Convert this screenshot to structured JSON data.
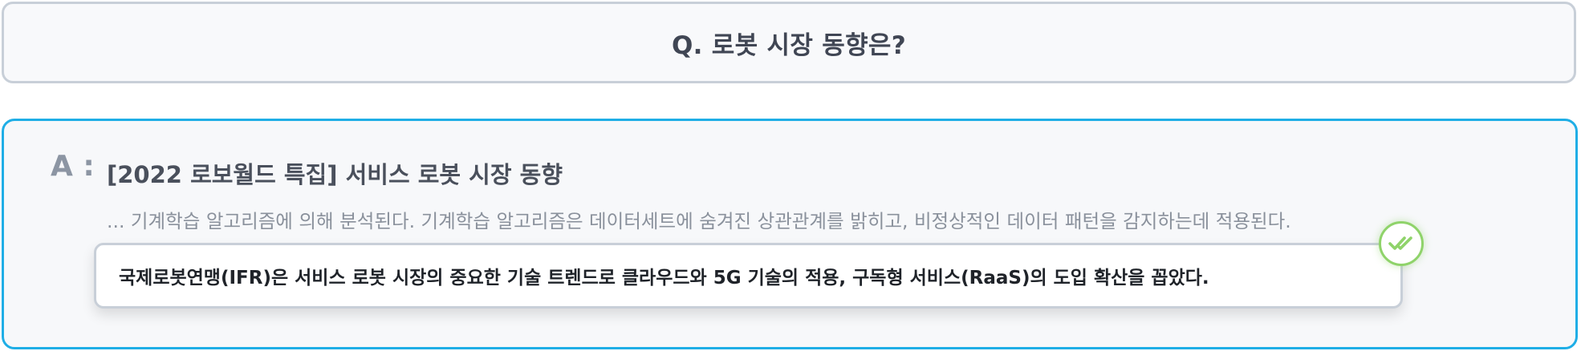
{
  "question": {
    "text": "Q. 로봇 시장 동향은?"
  },
  "answer": {
    "label": "A :",
    "title": "[2022 로보월드 특집] 서비스 로봇 시장 동향",
    "excerpt": "... 기계학습 알고리즘에 의해 분석된다. 기계학습 알고리즘은 데이터세트에 숨겨진 상관관계를 밝히고, 비정상적인 데이터 패턴을 감지하는데 적용된다.",
    "highlight": "국제로봇연맹(IFR)은 서비스 로봇 시장의 중요한 기술 트렌드로 클라우드와 5G 기술의 적용, 구독형 서비스(RaaS)의 도입 확산을 꼽았다.",
    "badge_icon": "double-check-icon"
  },
  "colors": {
    "answer_border": "#1faee6",
    "question_border": "#c8cfd8",
    "badge_green": "#8fd36a"
  }
}
